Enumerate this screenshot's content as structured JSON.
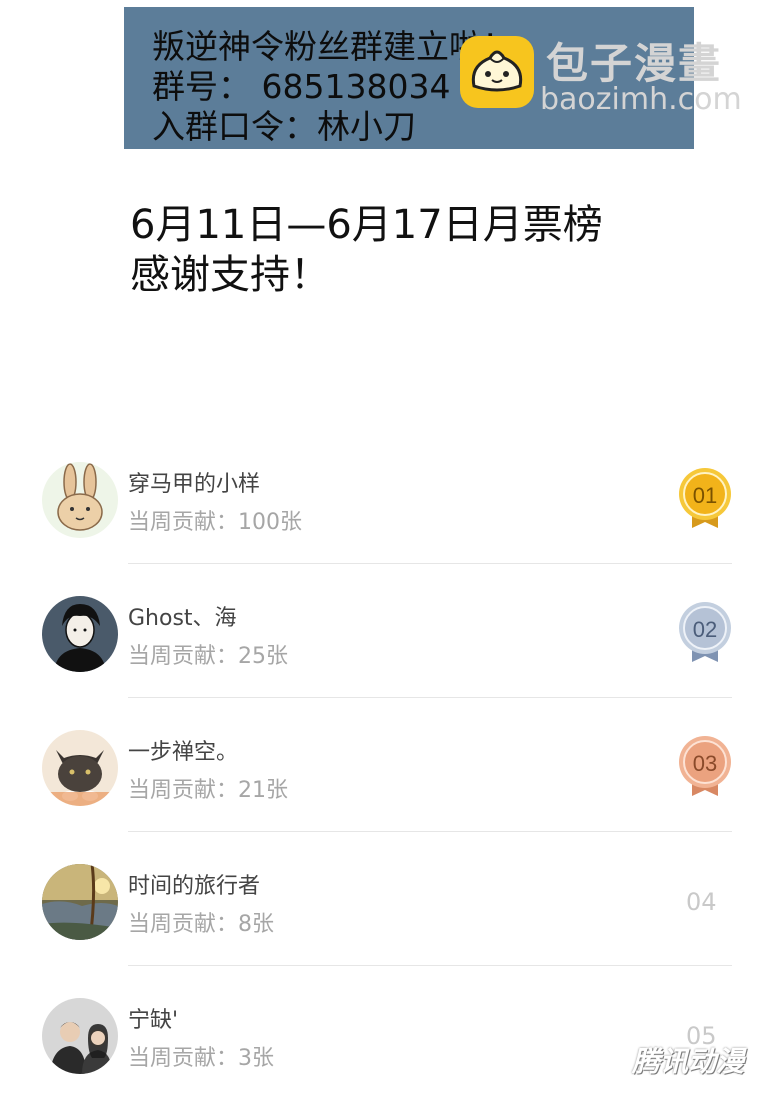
{
  "banner": {
    "line1": "叛逆神令粉丝群建立啦！",
    "line2": "群号： 685138034",
    "line3": "入群口令：林小刀"
  },
  "watermark": {
    "brand": "包子漫畫",
    "url": "baozimh.com",
    "bottom_logo": "腾讯动漫"
  },
  "heading": {
    "line1": "6月11日—6月17日月票榜",
    "line2": "感谢支持！"
  },
  "colors": {
    "banner_bg": "#5c7d99",
    "gold": "#f2b31a",
    "silver": "#9fb0c8",
    "bronze": "#e9a27c"
  },
  "ranking": [
    {
      "rank": "01",
      "name": "穿马甲的小样",
      "contribution": "当周贡献：100张",
      "medal": "gold",
      "avatar": "rabbit-avatar"
    },
    {
      "rank": "02",
      "name": "Ghost、海",
      "contribution": "当周贡献：25张",
      "medal": "silver",
      "avatar": "manga-boy-avatar"
    },
    {
      "rank": "03",
      "name": "一步禅空。",
      "contribution": "当周贡献：21张",
      "medal": "bronze",
      "avatar": "cat-avatar"
    },
    {
      "rank": "04",
      "name": "时间的旅行者",
      "contribution": "当周贡献：8张",
      "medal": "none",
      "avatar": "landscape-avatar"
    },
    {
      "rank": "05",
      "name": "宁缺'",
      "contribution": "当周贡献：3张",
      "medal": "none",
      "avatar": "couple-avatar"
    }
  ]
}
